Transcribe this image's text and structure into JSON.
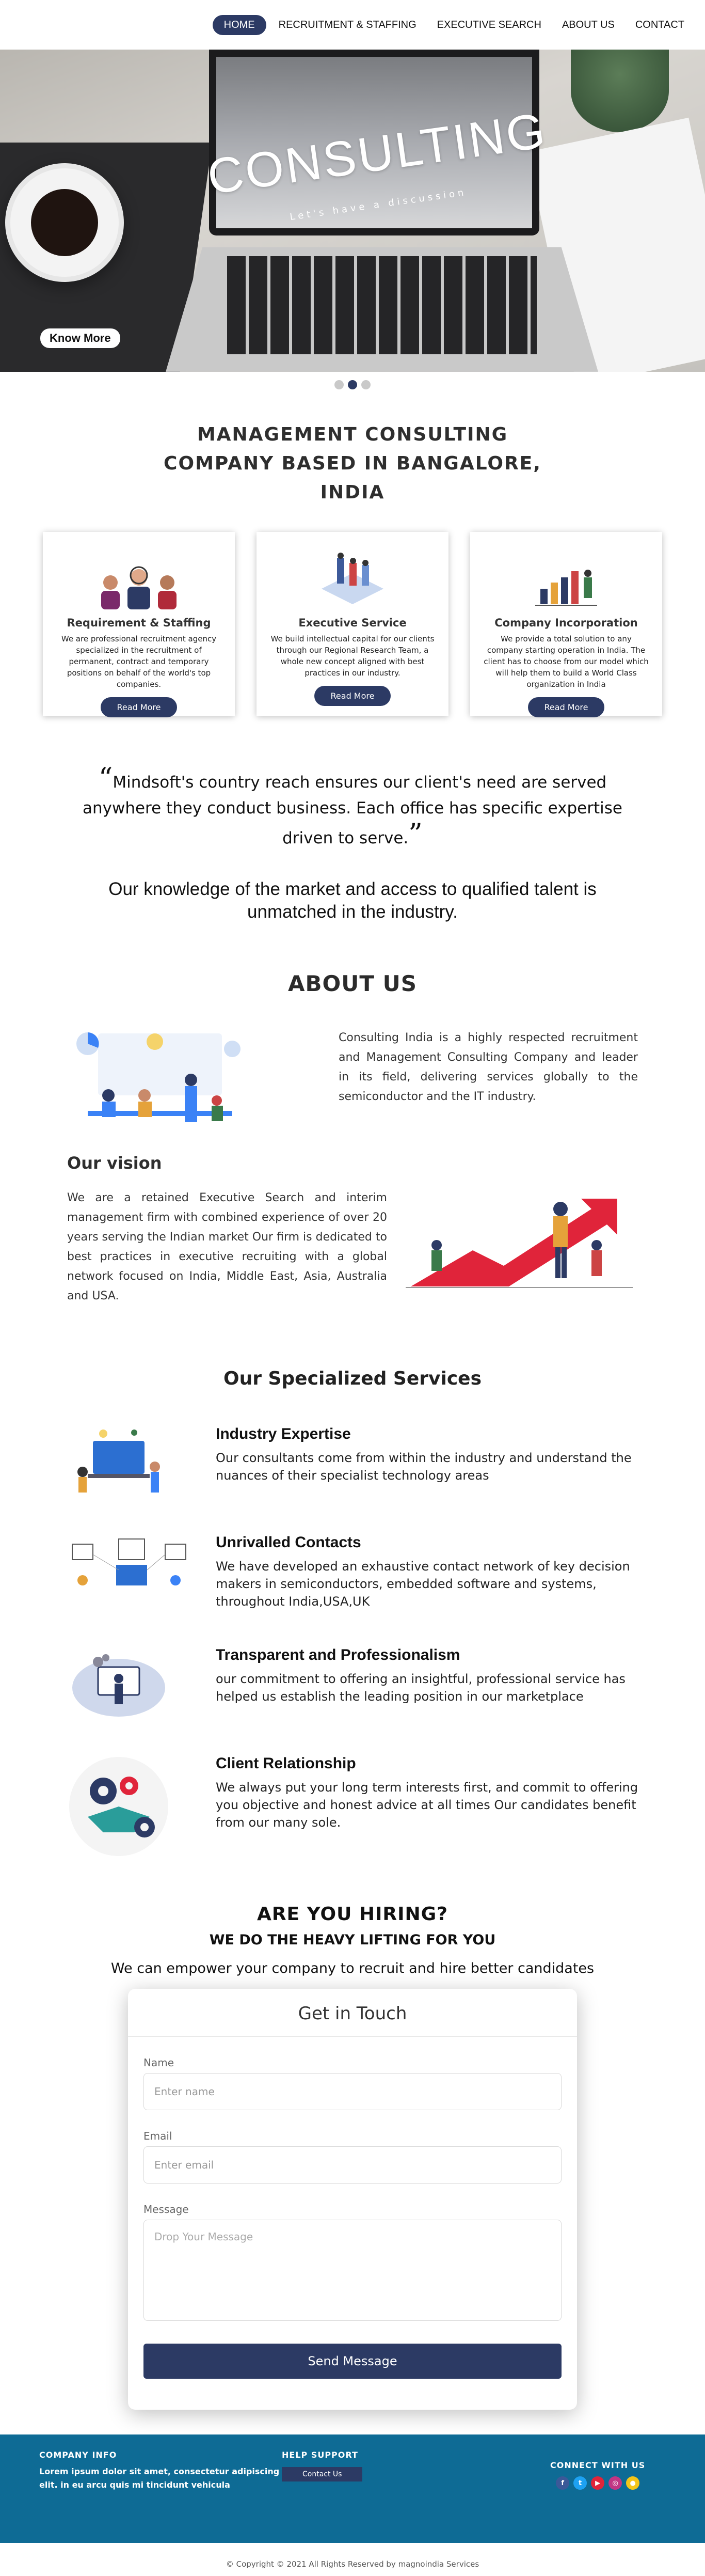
{
  "nav": {
    "items": [
      "HOME",
      "RECRUITMENT & STAFFING",
      "EXECUTIVE SEARCH",
      "ABOUT US",
      "CONTACT"
    ]
  },
  "hero": {
    "title": "CONSULTING",
    "subtitle": "Let's have a discussion",
    "button_label": "Know More"
  },
  "mgmt": {
    "title_line1": "MANAGEMENT CONSULTING",
    "title_line2": "COMPANY BASED IN BANGALORE,",
    "title_line3": "INDIA"
  },
  "cards": [
    {
      "title": "Requirement & Staffing",
      "text": "We are professional recruitment agency specialized in the recruitment of permanent, contract and temporary positions on behalf of the world's top companies.",
      "button": "Read More"
    },
    {
      "title": "Executive Service",
      "text": "We build intellectual capital for our clients through our Regional Research Team, a whole new concept aligned with best practices in our industry.",
      "button": "Read More"
    },
    {
      "title": "Company Incorporation",
      "text": "We provide a total solution to any company starting operation in India. The client has to choose from our model which will help them to build a World Class organization in India",
      "button": "Read More"
    }
  ],
  "quote": {
    "text": "Mindsoft's country reach ensures our client's need are served anywhere they conduct business. Each office has specific expertise driven to serve."
  },
  "knowledge": {
    "line1": "Our knowledge of the market and access to qualified talent is",
    "line2": "unmatched in the industry."
  },
  "about": {
    "title": "ABOUT US",
    "text": "Consulting India is a highly respected recruitment and Management Consulting Company and leader in its field, delivering services globally to the semiconductor and the IT industry.",
    "vision_title": "Our vision",
    "vision_text": "We are a retained Executive Search and interim management firm with combined experience of over 20 years serving the Indian market Our firm is dedicated to best practices in executive recruiting with a global network focused on India, Middle East, Asia, Australia and USA."
  },
  "services": {
    "title": "Our Specialized Services",
    "items": [
      {
        "title": "Industry Expertise",
        "text": "Our consultants come from within the industry and understand the nuances of their specialist technology areas"
      },
      {
        "title": "Unrivalled Contacts",
        "text": "We have developed an exhaustive contact network of key decision makers in semiconductors, embedded software and systems, throughout India,USA,UK"
      },
      {
        "title": "Transparent and Professionalism",
        "text": "our commitment to offering an insightful, professional service has helped us establish the leading position in our marketplace"
      },
      {
        "title": "Client Relationship",
        "text": "We always put your long term interests first, and commit to offering you objective and honest advice at all times Our candidates benefit from our many sole."
      }
    ]
  },
  "hiring": {
    "title": "ARE YOU HIRING?",
    "subtitle": "WE DO THE HEAVY LIFTING FOR YOU",
    "desc": "We can empower your company to recruit and hire better candidates"
  },
  "form": {
    "title": "Get in Touch",
    "name_label": "Name",
    "name_placeholder": "Enter name",
    "email_label": "Email",
    "email_placeholder": "Enter email",
    "message_label": "Message",
    "message_placeholder": "Drop Your Message",
    "submit": "Send Message"
  },
  "footer": {
    "company_head": "COMPANY INFO",
    "lorem": "Lorem ipsum dolor sit amet, consectetur adipiscing elit. in eu arcu quis mi tincidunt vehicula",
    "help_head": "HELP SUPPORT",
    "contact_btn": "Contact Us",
    "connect_head": "CONNECT WITH US",
    "copyright": "© Copyright © 2021 All Rights Reserved by magnoindia Services"
  },
  "colors": {
    "navy": "#2c3a64",
    "footer_blue": "#0e6b95"
  }
}
